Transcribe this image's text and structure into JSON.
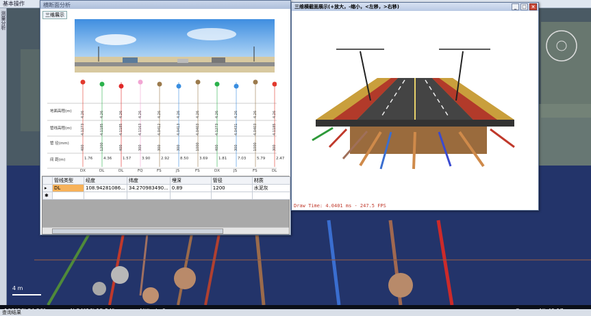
{
  "app": {
    "menu": [
      "基本操作"
    ],
    "side_tab": "测量分析"
  },
  "left_window": {
    "title": "横断面分析",
    "tab": "三维展示"
  },
  "profile": {
    "row_labels": [
      "地面高程(m)",
      "管线高程(m)",
      "管 径(mm)",
      "间 距(m)"
    ],
    "columns": [
      {
        "code": "DX",
        "color": "#e23a2e",
        "ground": "4.26",
        "pipe": "4.1273",
        "dia": "400",
        "dist": "1.76"
      },
      {
        "code": "DL",
        "color": "#2bb24c",
        "ground": "4.26",
        "pipe": "4.1185",
        "dia": "1200",
        "dist": "4.36"
      },
      {
        "code": "DL",
        "color": "#e02828",
        "ground": "4.26",
        "pipe": "4.1185",
        "dia": "400",
        "dist": "1.57"
      },
      {
        "code": "FQ",
        "color": "#f2a6d4",
        "ground": "4.26",
        "pipe": "4.1163",
        "dia": "300",
        "dist": "3.90"
      },
      {
        "code": "FS",
        "color": "#9b7a4c",
        "ground": "4.26",
        "pipe": "4.0412",
        "dia": "300",
        "dist": "2.92"
      },
      {
        "code": "JS",
        "color": "#3a8ee0",
        "ground": "4.26",
        "pipe": "4.0413",
        "dia": "300",
        "dist": "8.50"
      },
      {
        "code": "FS",
        "color": "#9b7a4c",
        "ground": "4.26",
        "pipe": "4.0403",
        "dia": "1000",
        "dist": "3.69"
      },
      {
        "code": "DX",
        "color": "#2bb24c",
        "ground": "4.26",
        "pipe": "4.1273",
        "dia": "400",
        "dist": "1.81"
      },
      {
        "code": "JS",
        "color": "#3a8ee0",
        "ground": "4.26",
        "pipe": "4.0431",
        "dia": "300",
        "dist": "7.03"
      },
      {
        "code": "FS",
        "color": "#9b7a4c",
        "ground": "4.26",
        "pipe": "4.0403",
        "dia": "1000",
        "dist": "5.79"
      },
      {
        "code": "DL",
        "color": "#e23a2e",
        "ground": "4.26",
        "pipe": "4.1185",
        "dia": "300",
        "dist": "2.47"
      }
    ]
  },
  "table": {
    "headers": [
      "管线类型",
      "经度",
      "纬度",
      "埋深",
      "管径",
      "材质"
    ],
    "rows": [
      [
        "DL",
        "108.94281086...",
        "34.270983490...",
        "0.89",
        "1200",
        "水泥灰"
      ]
    ]
  },
  "right_window": {
    "title": "三维横截面展示(+放大，-缩小，<左移，>右移)",
    "draw_time": "Draw Time: 4.0401 ms - 247.5 FPS"
  },
  "status": {
    "lon": "108°56' 34.56\"",
    "lat": "N 34°16' 15.54\"",
    "alt": "Altitude 0 m",
    "cam": "Camera Alt 49.17 m",
    "scale": "4 m",
    "bottom": "查询结果"
  },
  "colors": {
    "accent": "#3a6ea5"
  }
}
